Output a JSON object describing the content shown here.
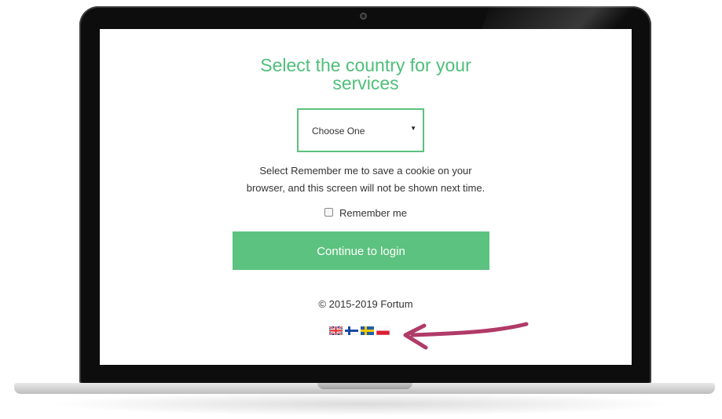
{
  "page": {
    "title": "Select the country for your services",
    "select": {
      "value": "Choose One"
    },
    "info_text_line1": "Select Remember me to save a cookie on your",
    "info_text_line2": "browser, and this screen will not be shown next time.",
    "remember_label": "Remember me",
    "remember_checked": false,
    "continue_label": "Continue to login",
    "copyright": "© 2015-2019 Fortum",
    "flags": [
      "uk-flag-icon",
      "finland-flag-icon",
      "sweden-flag-icon",
      "poland-flag-icon"
    ]
  },
  "colors": {
    "accent": "#5cc27f",
    "title": "#4ebf79",
    "annotation_arrow": "#b03a68"
  }
}
